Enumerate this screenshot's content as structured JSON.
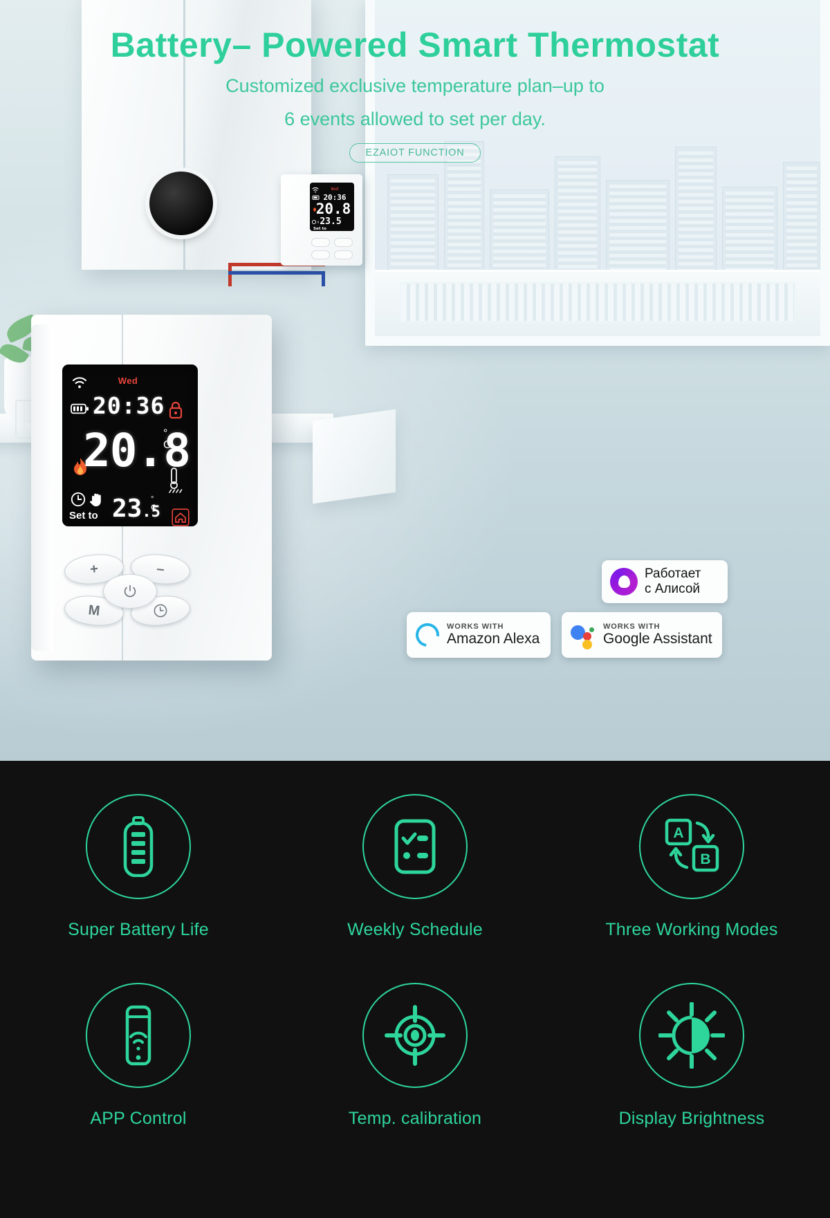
{
  "hero": {
    "title": "Battery– Powered Smart Thermostat",
    "subtitle_line1": "Customized exclusive temperature plan–up to",
    "subtitle_line2": "6 events allowed to set per day.",
    "badge_label": "EZAIOT FUNCTION",
    "accent_color": "#2ecf9a"
  },
  "thermostat": {
    "display": {
      "day": "Wed",
      "time": "20:36",
      "current_temp": "20.8",
      "current_unit_degree": "°",
      "current_unit_scale": "C",
      "set_to_label": "Set to",
      "set_temp": "23",
      "set_temp_decimal": ".5",
      "set_unit_degree": "°",
      "set_unit_scale": "C",
      "icons": {
        "wifi": "wifi-icon",
        "battery": "battery-icon",
        "flame": "flame-icon",
        "lock": "lock-icon",
        "thermometer": "thermometer-icon",
        "clock": "clock-icon",
        "hand": "hand-icon",
        "home": "home-icon"
      },
      "day_color": "#e8453c",
      "lock_color": "#e8453c",
      "flame_color": "#ef5a2a"
    },
    "buttons": {
      "plus": "+",
      "minus": "–",
      "mode": "M",
      "timer": "clock-icon",
      "power": "power-icon"
    }
  },
  "assistant_badges": [
    {
      "id": "alice",
      "logo": "yandex-alice-logo",
      "line1": "Работает",
      "line2": "с Алисой",
      "brand_color": "#a21bd8"
    },
    {
      "id": "alexa",
      "logo": "amazon-alexa-logo",
      "kicker": "WORKS WITH",
      "name": "Amazon Alexa",
      "brand_color": "#27b5e8"
    },
    {
      "id": "google",
      "logo": "google-assistant-logo",
      "kicker": "WORKS WITH",
      "name": "Google Assistant",
      "brand_color": "#3f82f2"
    }
  ],
  "features": {
    "accent_color": "#2ed69c",
    "background_color": "#111111",
    "rows": [
      [
        {
          "icon": "battery-icon",
          "label": "Super Battery Life"
        },
        {
          "icon": "checklist-icon",
          "label": "Weekly Schedule"
        },
        {
          "icon": "ab-swap-icon",
          "label": "Three Working Modes"
        }
      ],
      [
        {
          "icon": "phone-wifi-icon",
          "label": "APP Control"
        },
        {
          "icon": "crosshair-icon",
          "label": "Temp. calibration"
        },
        {
          "icon": "brightness-icon",
          "label": "Display Brightness"
        }
      ]
    ]
  }
}
